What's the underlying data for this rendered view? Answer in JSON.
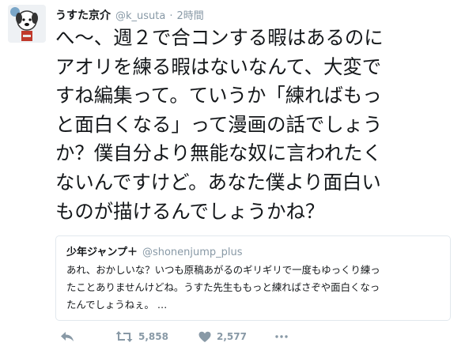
{
  "tweet": {
    "display_name": "うすた京介",
    "handle": "@k_usuta",
    "separator": "·",
    "time": "2時間",
    "text_lines": [
      "へ～、週２で合コンする暇はあるのに",
      "アオリを練る暇はないなんて、大変で",
      "すね編集って。ていうか「練ればもっ",
      "と面白くなる」って漫画の話でしょう",
      "か？僕自分より無能な奴に言われたく",
      "ないんですけど。あなた僕より面白い",
      "ものが描けるんでしょうかね？"
    ]
  },
  "quote": {
    "display_name": "少年ジャンプ＋",
    "handle": "@shonenjump_plus",
    "text_lines": [
      "あれ、おかしいな？いつも原稿あがるのギリギリで一度もゆっくり練っ",
      "たことありませんけどね。うすた先生ももっと練ればさぞや面白くなっ",
      "たんでしょうねぇ。 …"
    ]
  },
  "actions": {
    "retweet_count": "5,858",
    "like_count": "2,577"
  },
  "icons": {
    "reply": "reply-icon",
    "retweet": "retweet-icon",
    "like": "heart-icon",
    "more": "more-icon"
  },
  "colors": {
    "text": "#14171a",
    "secondary": "#8899a6",
    "border": "#e1e8ed"
  }
}
